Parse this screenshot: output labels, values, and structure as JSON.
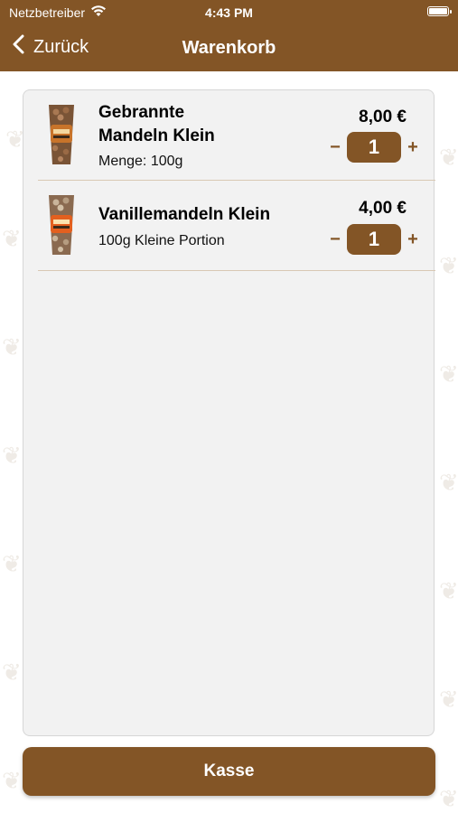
{
  "status_bar": {
    "carrier": "Netzbetreiber",
    "time": "4:43 PM"
  },
  "nav": {
    "back_label": "Zurück",
    "title": "Warenkorb"
  },
  "cart": {
    "items": [
      {
        "name": "Gebrannte Mandeln Klein",
        "name_line1": "Gebrannte",
        "name_line2": "Mandeln Klein",
        "subtitle": "Menge: 100g",
        "price": "8,00 €",
        "quantity": "1",
        "minus": "−",
        "plus": "+",
        "label_color": "#c8742a"
      },
      {
        "name": "Vanillemandeln Klein",
        "subtitle": "100g Kleine Portion",
        "price": "4,00 €",
        "quantity": "1",
        "minus": "−",
        "plus": "+",
        "label_color": "#e3601f"
      }
    ]
  },
  "checkout": {
    "label": "Kasse"
  },
  "colors": {
    "brand": "#835526",
    "card_bg": "#f2f2f2"
  },
  "icons": {
    "back": "chevron-left-icon",
    "wifi": "wifi-icon",
    "battery": "battery-icon",
    "background": "almond-pattern-icon"
  }
}
